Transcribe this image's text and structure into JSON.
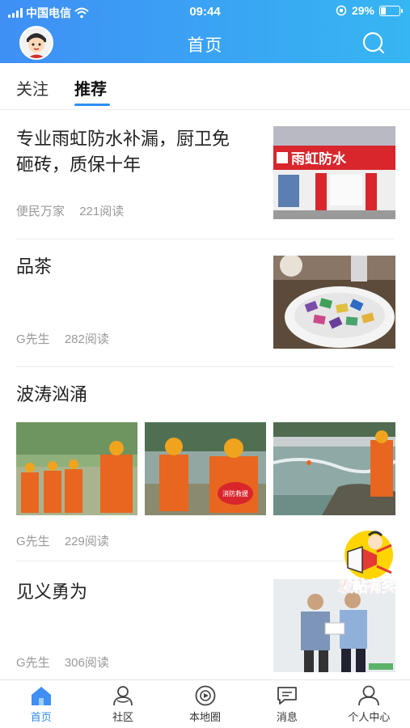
{
  "status_bar": {
    "carrier": "中国电信",
    "time": "09:44",
    "battery": "29%",
    "battery_level": 0.29
  },
  "header": {
    "title": "首页"
  },
  "tabs": [
    {
      "label": "关注",
      "active": false
    },
    {
      "label": "推荐",
      "active": true
    }
  ],
  "feed": [
    {
      "title_line1": "专业雨虹防水补漏，厨卫免",
      "title_line2": "砸砖，质保十年",
      "author": "便民万家",
      "reads": "221阅读",
      "image_signage": "雨虹防水"
    },
    {
      "title": "品茶",
      "author": "G先生",
      "reads": "282阅读"
    },
    {
      "title": "波涛汹涌",
      "author": "G先生",
      "reads": "229阅读",
      "badge_text": "消防救援"
    },
    {
      "title": "见义勇为",
      "author": "G先生",
      "reads": "306阅读"
    }
  ],
  "fab": {
    "label": "发帖有奖"
  },
  "bottom_nav": [
    {
      "label": "首页",
      "icon": "home-icon",
      "active": true
    },
    {
      "label": "社区",
      "icon": "community-icon",
      "active": false
    },
    {
      "label": "本地圈",
      "icon": "local-circle-icon",
      "active": false
    },
    {
      "label": "消息",
      "icon": "message-icon",
      "active": false
    },
    {
      "label": "个人中心",
      "icon": "profile-icon",
      "active": false
    }
  ],
  "colors": {
    "header_start": "#3f8ff5",
    "header_end": "#36b6f2",
    "accent": "#3189f0",
    "meta": "#999999"
  }
}
